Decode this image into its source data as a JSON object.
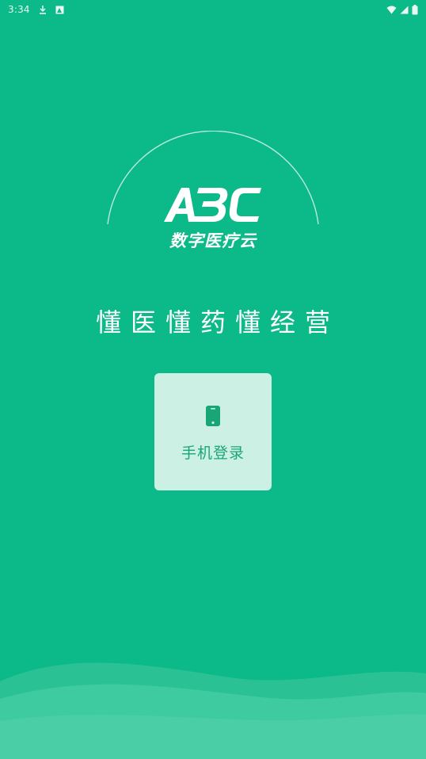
{
  "status_bar": {
    "time": "3:34",
    "left_icons": [
      "download-icon",
      "image-icon"
    ],
    "right_icons": [
      "wifi-icon",
      "signal-icon",
      "battery-icon"
    ]
  },
  "brand": {
    "logo_text": "ABC",
    "subtitle": "数字医疗云"
  },
  "slogan": "懂医懂药懂经营",
  "login": {
    "icon": "phone-icon",
    "label": "手机登录"
  },
  "colors": {
    "background": "#0cb988",
    "card": "#ccf0e4",
    "card_text": "#19a676",
    "wave_light": "#3ecb9f"
  }
}
